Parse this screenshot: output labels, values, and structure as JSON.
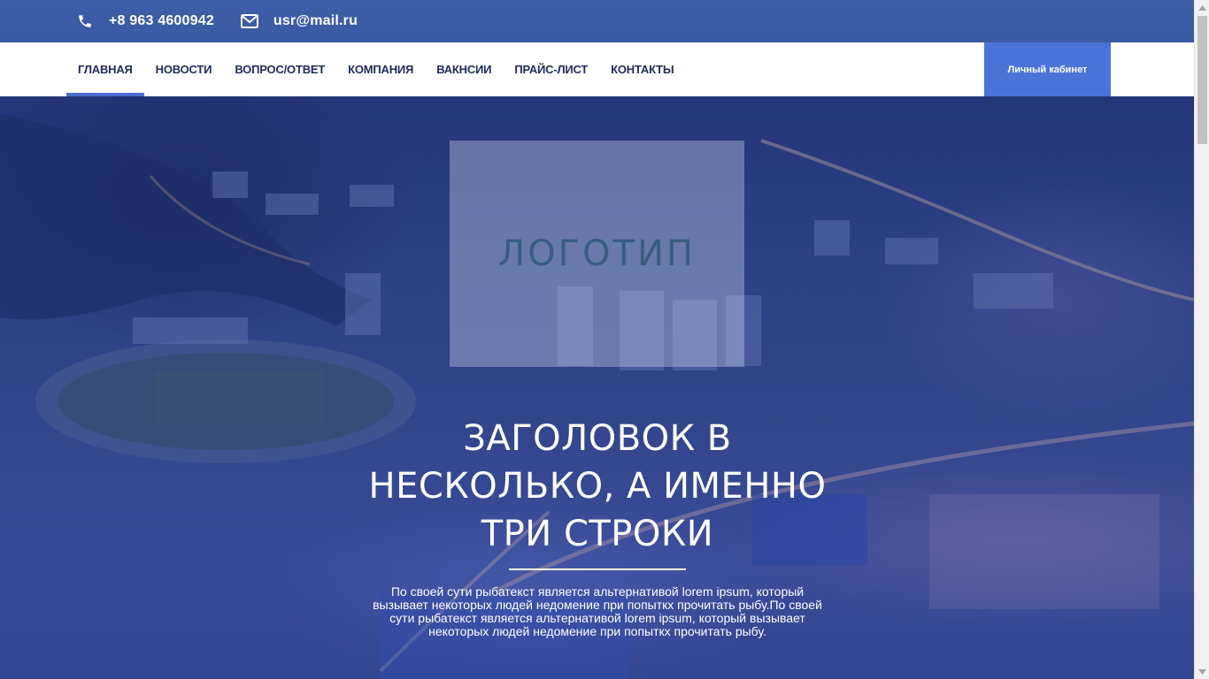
{
  "topbar": {
    "phone": {
      "icon": "phone-icon",
      "text": "+8 963 4600942"
    },
    "email": {
      "icon": "envelope-icon",
      "text": "usr@mail.ru"
    }
  },
  "nav": {
    "items": [
      {
        "label": "ГЛАВНАЯ",
        "active": true
      },
      {
        "label": "НОВОСТИ"
      },
      {
        "label": "ВОПРОС/ОТВЕТ"
      },
      {
        "label": "КОМПАНИЯ"
      },
      {
        "label": "ВАКНСИИ"
      },
      {
        "label": "ПРАЙС-ЛИСТ"
      },
      {
        "label": "КОНТАКТЫ"
      }
    ],
    "cabinet_button": "Личный кабинет"
  },
  "hero": {
    "logo_text": "ЛОГОТИП",
    "headline_lines": [
      "ЗАГОЛОВОК В",
      "НЕСКОЛЬКО, А ИМЕННО",
      "ТРИ СТРОКИ"
    ],
    "description_lines": [
      "По своей сути рыбатекст является альтернативой lorem ipsum, который",
      "вызывает некоторых людей недомение при попыткх прочитать рыбу.По своей",
      "сути рыбатекст является альтернативой lorem ipsum, который вызывает",
      "некоторых людей недомение при попыткх прочитать рыбу."
    ]
  },
  "colors": {
    "topbar": "#3d5ea8",
    "nav_text": "#1e2c5c",
    "accent": "#4b74d8"
  }
}
